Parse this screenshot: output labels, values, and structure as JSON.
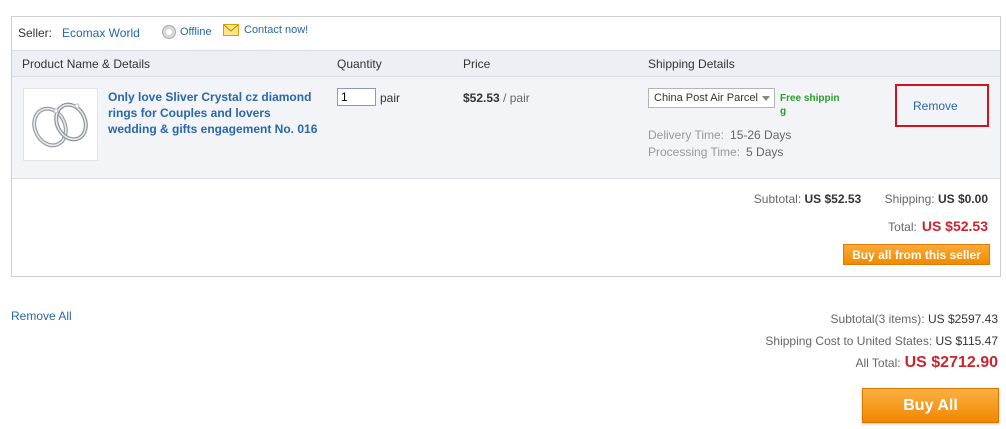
{
  "seller": {
    "label": "Seller:",
    "name": "Ecomax World",
    "status": "Offline",
    "contact": "Contact now!"
  },
  "table_headers": {
    "product": "Product Name & Details",
    "quantity": "Quantity",
    "price": "Price",
    "shipping": "Shipping Details"
  },
  "item": {
    "name": "Only love Sliver Crystal cz diamond rings for Couples and lovers wedding & gifts engagement No. 016",
    "quantity": "1",
    "quantity_unit": "pair",
    "price": "$52.53",
    "price_unit": "/ pair",
    "shipping_method": "China Post Air Parcel",
    "free_shipping": "Free shipping",
    "delivery_label": "Delivery Time:",
    "delivery_value": "15-26 Days",
    "processing_label": "Processing Time:",
    "processing_value": "5 Days",
    "remove": "Remove"
  },
  "seller_summary": {
    "subtotal_label": "Subtotal:",
    "subtotal_value": "US $52.53",
    "shipping_label": "Shipping:",
    "shipping_value": "US $0.00",
    "total_label": "Total:",
    "total_value": "US $52.53",
    "buy_button": "Buy all from this seller"
  },
  "cart": {
    "remove_all": "Remove All",
    "subtotal_label": "Subtotal(3 items):",
    "subtotal_value": "US $2597.43",
    "shipping_label": "Shipping Cost to United States:",
    "shipping_value": "US $115.47",
    "all_total_label": "All Total:",
    "all_total_value": "US $2712.90",
    "buy_all": "Buy All"
  },
  "colors": {
    "link": "#2767aa",
    "price_red": "#c9252f",
    "button_orange": "#f08a00",
    "free_ship_green": "#2a9d2a",
    "highlight_red": "#d0141d"
  }
}
